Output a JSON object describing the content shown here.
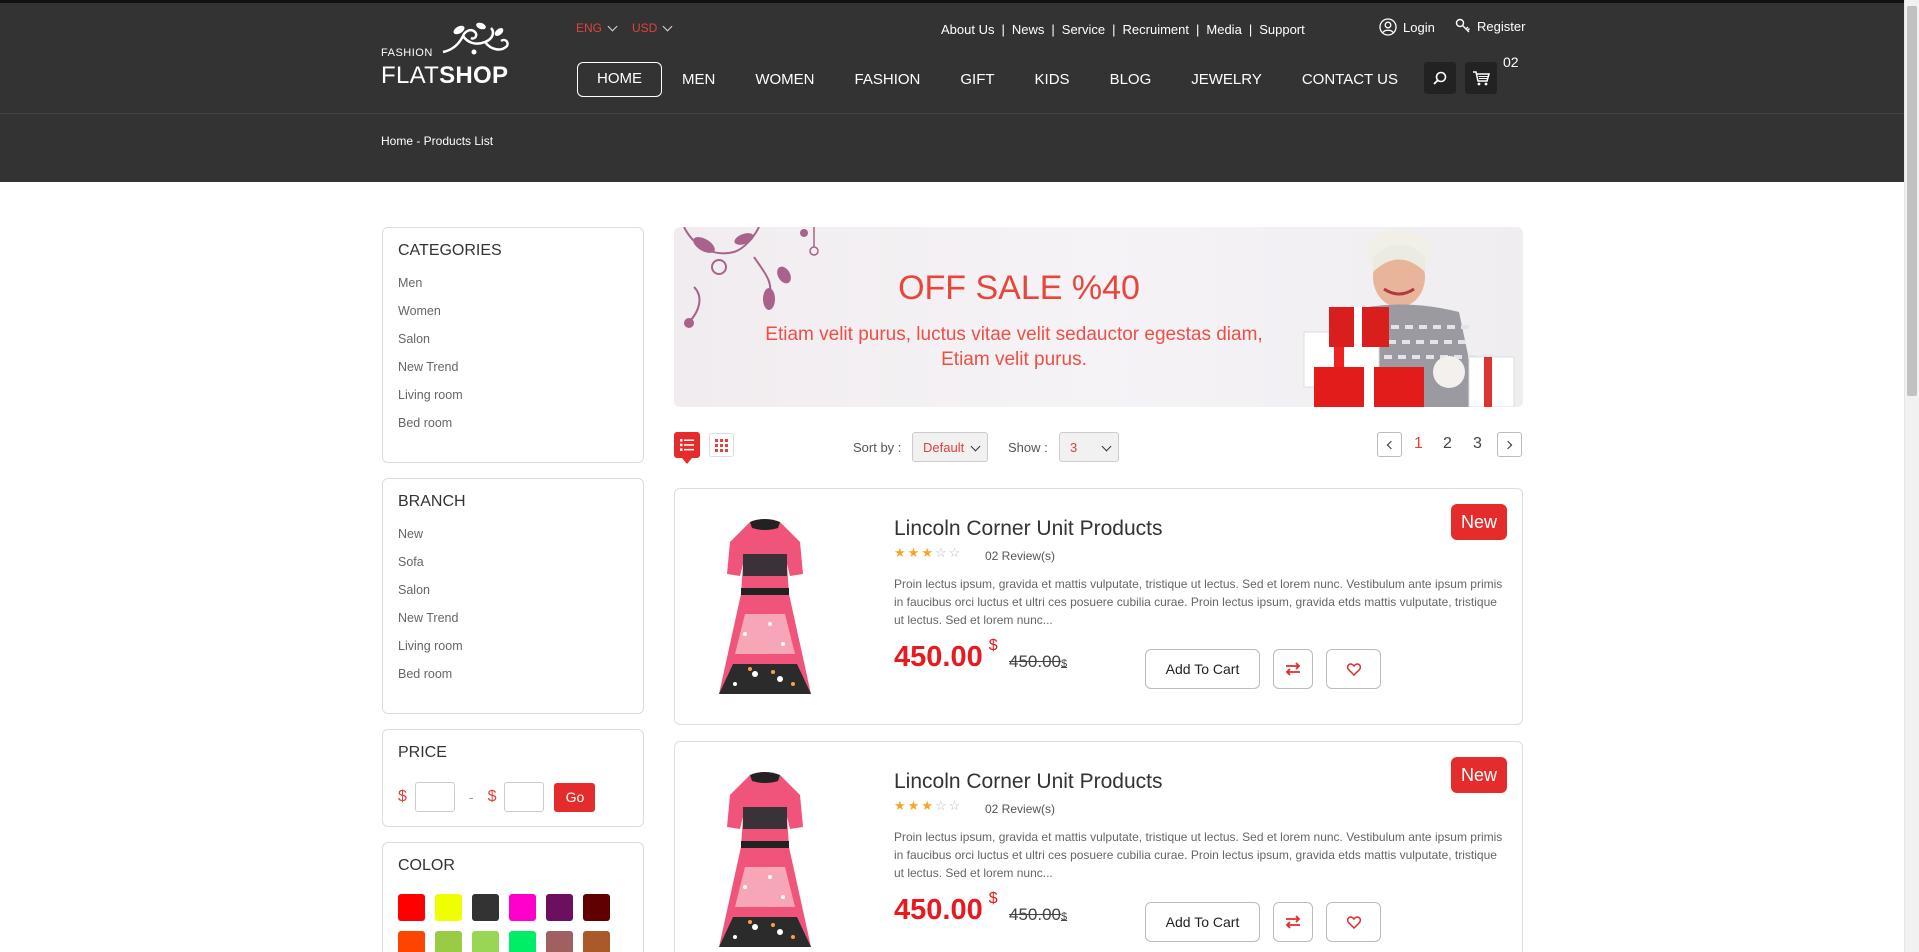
{
  "header": {
    "logo_small": "FASHION",
    "logo_part1": "FLAT",
    "logo_part2": "SHOP",
    "language": "ENG",
    "currency": "USD",
    "top_links": [
      "About Us",
      "News",
      "Service",
      "Recruiment",
      "Media",
      "Support"
    ],
    "login": "Login",
    "register": "Register",
    "nav": [
      "HOME",
      "MEN",
      "WOMEN",
      "FASHION",
      "GIFT",
      "KIDS",
      "BLOG",
      "JEWELRY",
      "CONTACT US"
    ],
    "cart_count": "02"
  },
  "breadcrumb": "Home - Products List",
  "sidebar": {
    "categories": {
      "title": "CATEGORIES",
      "items": [
        "Men",
        "Women",
        "Salon",
        "New Trend",
        "Living room",
        "Bed room"
      ]
    },
    "branch": {
      "title": "BRANCH",
      "items": [
        "New",
        "Sofa",
        "Salon",
        "New Trend",
        "Living room",
        "Bed room"
      ]
    },
    "price": {
      "title": "PRICE",
      "currency_symbol": "$",
      "separator": "-",
      "go_label": "Go"
    },
    "color": {
      "title": "COLOR",
      "swatches": [
        "#ff0000",
        "#f0ff00",
        "#333333",
        "#ff00cc",
        "#6b0f5e",
        "#600000",
        "#ff4400",
        "#99cc44",
        "#99d655",
        "#00ee66",
        "#a06060",
        "#aa5a28"
      ]
    }
  },
  "banner": {
    "title": "OFF SALE %40",
    "text": "Etiam velit purus, luctus vitae velit sedauctor egestas diam, Etiam velit purus."
  },
  "toolbar": {
    "sort_label": "Sort by :",
    "sort_value": "Default",
    "show_label": "Show :",
    "show_value": "3",
    "pages": [
      "1",
      "2",
      "3"
    ],
    "current_page": "1"
  },
  "products": [
    {
      "title": "Lincoln Corner Unit Products",
      "rating": 3,
      "rating_max": 5,
      "reviews": "02 Review(s)",
      "description": "Proin lectus ipsum, gravida et mattis vulputate, tristique ut lectus. Sed et lorem nunc. Vestibulum ante ipsum primis in faucibus orci luctus et ultri ces posuere cubilia curae. Proin lectus ipsum, gravida etds mattis vulputate, tristique ut lectus. Sed et lorem nunc...",
      "price": "450.00",
      "currency": "$",
      "old_price": "450.00",
      "badge": "New",
      "add_to_cart": "Add To Cart"
    },
    {
      "title": "Lincoln Corner Unit Products",
      "rating": 3,
      "rating_max": 5,
      "reviews": "02 Review(s)",
      "description": "Proin lectus ipsum, gravida et mattis vulputate, tristique ut lectus. Sed et lorem nunc. Vestibulum ante ipsum primis in faucibus orci luctus et ultri ces posuere cubilia curae. Proin lectus ipsum, gravida etds mattis vulputate, tristique ut lectus. Sed et lorem nunc...",
      "price": "450.00",
      "currency": "$",
      "old_price": "450.00",
      "badge": "New",
      "add_to_cart": "Add To Cart"
    }
  ],
  "colors": {
    "accent": "#e52c2c",
    "header_bg": "#333333",
    "star": "#f5a623"
  }
}
